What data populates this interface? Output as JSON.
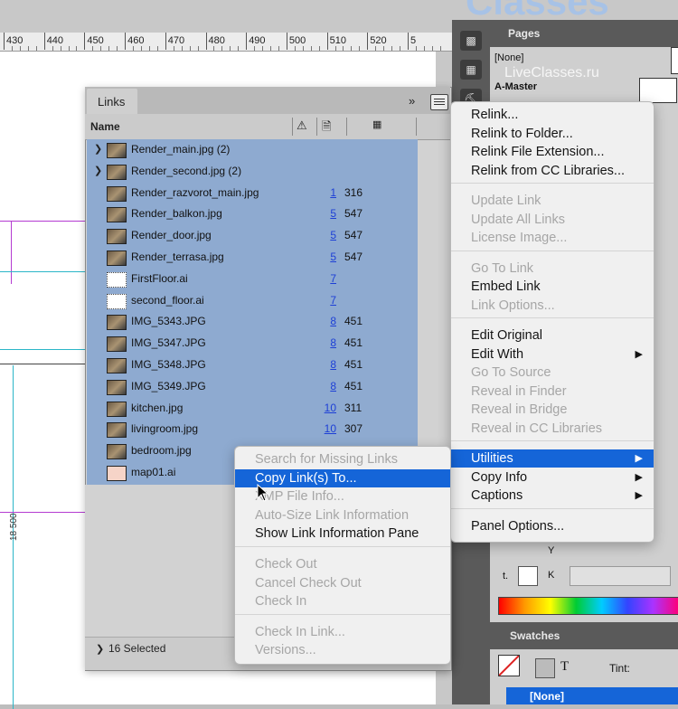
{
  "watermark": {
    "brand": "Classes",
    "site": "LiveClasses.ru"
  },
  "ruler": {
    "ticks": [
      "430",
      "440",
      "450",
      "460",
      "470",
      "480",
      "490",
      "500",
      "510",
      "520",
      "5"
    ]
  },
  "canvas": {
    "dimension_label": "18 500"
  },
  "pages_panel": {
    "title": "Pages",
    "none_label": "[None]",
    "master_label": "A-Master"
  },
  "links_panel": {
    "tab_label": "Links",
    "collapse_glyph": "»",
    "column_name": "Name",
    "columns_icons": [
      "alert-icon",
      "page-icon",
      "grid-icon"
    ],
    "rows": [
      {
        "name": "Render_main.jpg (2)",
        "page": "",
        "ppi": "",
        "expandable": true,
        "thumb": "photo"
      },
      {
        "name": "Render_second.jpg (2)",
        "page": "",
        "ppi": "",
        "expandable": true,
        "thumb": "photo"
      },
      {
        "name": "Render_razvorot_main.jpg",
        "page": "1",
        "ppi": "316",
        "expandable": false,
        "thumb": "photo"
      },
      {
        "name": "Render_balkon.jpg",
        "page": "5",
        "ppi": "547",
        "expandable": false,
        "thumb": "photo"
      },
      {
        "name": "Render_door.jpg",
        "page": "5",
        "ppi": "547",
        "expandable": false,
        "thumb": "photo"
      },
      {
        "name": "Render_terrasa.jpg",
        "page": "5",
        "ppi": "547",
        "expandable": false,
        "thumb": "photo"
      },
      {
        "name": "FirstFloor.ai",
        "page": "7",
        "ppi": "",
        "expandable": false,
        "thumb": "ai"
      },
      {
        "name": "second_floor.ai",
        "page": "7",
        "ppi": "",
        "expandable": false,
        "thumb": "ai"
      },
      {
        "name": "IMG_5343.JPG",
        "page": "8",
        "ppi": "451",
        "expandable": false,
        "thumb": "photo"
      },
      {
        "name": "IMG_5347.JPG",
        "page": "8",
        "ppi": "451",
        "expandable": false,
        "thumb": "photo"
      },
      {
        "name": "IMG_5348.JPG",
        "page": "8",
        "ppi": "451",
        "expandable": false,
        "thumb": "photo"
      },
      {
        "name": "IMG_5349.JPG",
        "page": "8",
        "ppi": "451",
        "expandable": false,
        "thumb": "photo"
      },
      {
        "name": "kitchen.jpg",
        "page": "10",
        "ppi": "311",
        "expandable": false,
        "thumb": "photo"
      },
      {
        "name": "livingroom.jpg",
        "page": "10",
        "ppi": "307",
        "expandable": false,
        "thumb": "photo"
      },
      {
        "name": "bedroom.jpg",
        "page": "",
        "ppi": "",
        "expandable": false,
        "thumb": "photo"
      },
      {
        "name": "map01.ai",
        "page": "",
        "ppi": "",
        "expandable": false,
        "thumb": "ai2"
      }
    ],
    "footer_status": "16 Selected"
  },
  "panel_menu": {
    "items": [
      {
        "label": "Relink...",
        "enabled": true
      },
      {
        "label": "Relink to Folder...",
        "enabled": true
      },
      {
        "label": "Relink File Extension...",
        "enabled": true
      },
      {
        "label": "Relink from CC Libraries...",
        "enabled": true
      },
      {
        "sep": true
      },
      {
        "label": "Update Link",
        "enabled": false
      },
      {
        "label": "Update All Links",
        "enabled": false
      },
      {
        "label": "License Image...",
        "enabled": false
      },
      {
        "sep": true
      },
      {
        "label": "Go To Link",
        "enabled": false
      },
      {
        "label": "Embed Link",
        "enabled": true
      },
      {
        "label": "Link Options...",
        "enabled": false
      },
      {
        "sep": true
      },
      {
        "label": "Edit Original",
        "enabled": true
      },
      {
        "label": "Edit With",
        "enabled": true,
        "submenu": true
      },
      {
        "label": "Go To Source",
        "enabled": false
      },
      {
        "label": "Reveal in Finder",
        "enabled": false
      },
      {
        "label": "Reveal in Bridge",
        "enabled": false
      },
      {
        "label": "Reveal in CC Libraries",
        "enabled": false
      },
      {
        "sep": true
      },
      {
        "label": "Utilities",
        "enabled": true,
        "submenu": true,
        "highlighted": true
      },
      {
        "label": "Copy Info",
        "enabled": true,
        "submenu": true
      },
      {
        "label": "Captions",
        "enabled": true,
        "submenu": true
      },
      {
        "sep": true
      },
      {
        "label": "Panel Options...",
        "enabled": true
      }
    ]
  },
  "utilities_submenu": {
    "items": [
      {
        "label": "Search for Missing Links",
        "enabled": false
      },
      {
        "label": "Copy Link(s) To...",
        "enabled": true,
        "highlighted": true
      },
      {
        "label": "XMP File Info...",
        "enabled": false
      },
      {
        "label": "Auto-Size Link Information",
        "enabled": false
      },
      {
        "label": "Show Link Information Pane",
        "enabled": true
      },
      {
        "sep": true
      },
      {
        "label": "Check Out",
        "enabled": false
      },
      {
        "label": "Cancel Check Out",
        "enabled": false
      },
      {
        "label": "Check In",
        "enabled": false
      },
      {
        "sep": true
      },
      {
        "label": "Check In Link...",
        "enabled": false
      },
      {
        "label": "Versions...",
        "enabled": false
      }
    ]
  },
  "right_panels": {
    "y_label": "Y",
    "k_label": "K",
    "t_label": "t.",
    "swatches_title": "Swatches",
    "tint_label": "Tint:",
    "none_swatch": "[None]"
  },
  "colors": {
    "selection": "#8eaad0",
    "highlight": "#1565d8",
    "link_number": "#1d3fd6"
  }
}
